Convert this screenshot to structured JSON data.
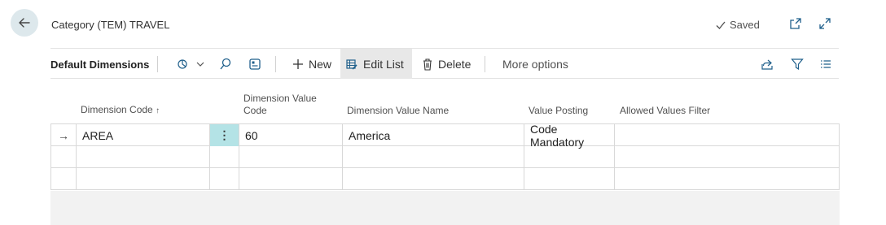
{
  "header": {
    "back_label": "←",
    "title": "Category (TEM) TRAVEL",
    "saved_label": "Saved"
  },
  "toolbar": {
    "title": "Default Dimensions",
    "new_label": "New",
    "edit_list_label": "Edit List",
    "delete_label": "Delete",
    "more_options_label": "More options"
  },
  "grid": {
    "columns": {
      "dimension_code": "Dimension Code",
      "sort_indicator": "↑",
      "dimension_value_code_1": "Dimension Value",
      "dimension_value_code_2": "Code",
      "dimension_value_name": "Dimension Value Name",
      "value_posting": "Value Posting",
      "allowed_values_filter": "Allowed Values Filter"
    },
    "rows": [
      {
        "indicator": "→",
        "dimension_code": "AREA",
        "menu": "⋮",
        "dimension_value_code": "60",
        "dimension_value_name": "America",
        "value_posting": "Code Mandatory",
        "allowed_values_filter": ""
      },
      {
        "indicator": "",
        "dimension_code": "",
        "menu": "",
        "dimension_value_code": "",
        "dimension_value_name": "",
        "value_posting": "",
        "allowed_values_filter": ""
      },
      {
        "indicator": "",
        "dimension_code": "",
        "menu": "",
        "dimension_value_code": "",
        "dimension_value_name": "",
        "value_posting": "",
        "allowed_values_filter": ""
      }
    ]
  },
  "colors": {
    "accent_selected_cell": "#b4e3e6",
    "back_button_bg": "#dde8ec",
    "icon_blue": "#1f5f8b"
  }
}
